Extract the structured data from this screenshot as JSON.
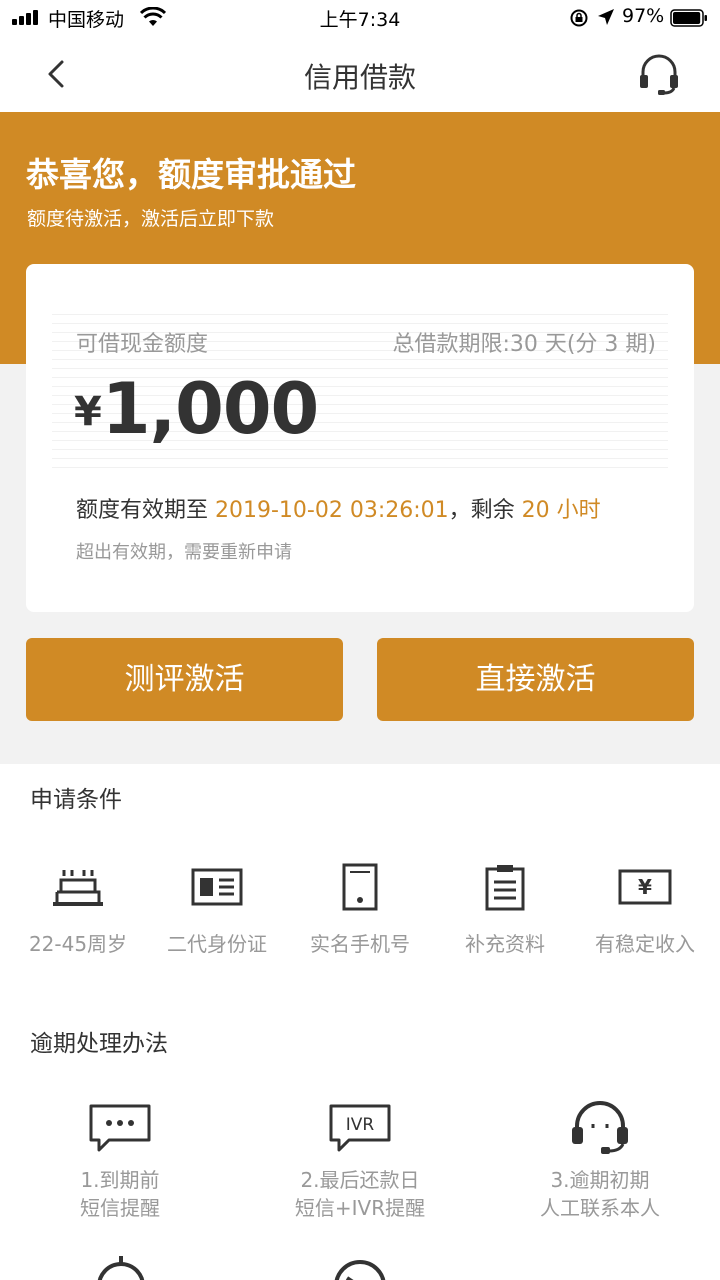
{
  "status_bar": {
    "carrier": "中国移动",
    "time": "上午7:34",
    "battery_percent": "97%",
    "battery_level": 0.97
  },
  "nav": {
    "title": "信用借款",
    "back_icon": "chevron-left-icon",
    "service_icon": "headset-icon"
  },
  "banner": {
    "title": "恭喜您，额度审批通过",
    "subtitle": "额度待激活，激活后立即下款",
    "color": "#d08a25"
  },
  "card": {
    "label": "可借现金额度",
    "term": "总借款期限:30 天(分 3 期)",
    "currency": "¥",
    "amount": "1,000",
    "valid_prefix": "额度有效期至 ",
    "valid_date": "2019-10-02 03:26:01",
    "valid_mid": "，剩余 ",
    "remaining": "20 小时",
    "note": "超出有效期，需要重新申请"
  },
  "buttons": {
    "evaluate": "测评激活",
    "direct": "直接激活"
  },
  "conditions": {
    "title": "申请条件",
    "items": [
      {
        "icon": "birthday-cake-icon",
        "label": "22-45周岁"
      },
      {
        "icon": "id-card-icon",
        "label": "二代身份证"
      },
      {
        "icon": "mobile-phone-icon",
        "label": "实名手机号"
      },
      {
        "icon": "clipboard-icon",
        "label": "补充资料"
      },
      {
        "icon": "income-yen-icon",
        "label": "有稳定收入"
      }
    ]
  },
  "overdue": {
    "title": "逾期处理办法",
    "items": [
      {
        "icon": "sms-bubble-icon",
        "line1": "1.到期前",
        "line2": "短信提醒"
      },
      {
        "icon": "ivr-bubble-icon",
        "icon_text": "IVR",
        "line1": "2.最后还款日",
        "line2": "短信+IVR提醒"
      },
      {
        "icon": "headset-icon",
        "line1": "3.逾期初期",
        "line2": "人工联系本人"
      }
    ]
  }
}
